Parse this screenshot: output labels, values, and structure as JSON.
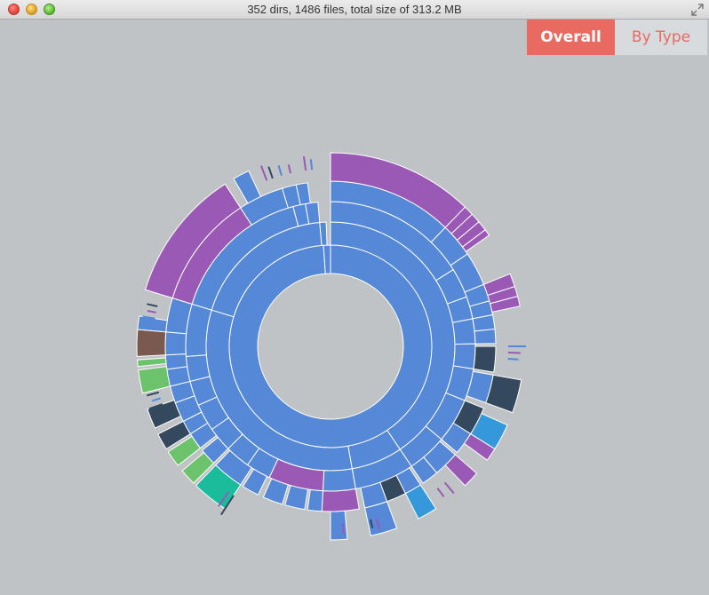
{
  "window": {
    "title": "352 dirs, 1486 files, total size of 313.2 MB"
  },
  "tabs": {
    "overall_label": "Overall",
    "bytype_label": "By Type",
    "active": "overall"
  },
  "colors": {
    "folder": "#5588d6",
    "purple": "#9b59b6",
    "dark": "#34495e",
    "green": "#6cc36c",
    "teal": "#1abc9c",
    "blue": "#3498db",
    "brown": "#7a5a50",
    "tab_active_bg": "#e96a60",
    "background": "#bfc3c6"
  },
  "chart_data": {
    "type": "sunburst",
    "segments": [
      {
        "depth": 0,
        "start": 0,
        "end": 356,
        "color": "folder"
      },
      {
        "depth": 0,
        "start": 356,
        "end": 360,
        "color": "folder"
      },
      {
        "depth": 1,
        "start": 0,
        "end": 146,
        "color": "folder"
      },
      {
        "depth": 1,
        "start": 146,
        "end": 170,
        "color": "folder"
      },
      {
        "depth": 1,
        "start": 170,
        "end": 287,
        "color": "folder"
      },
      {
        "depth": 1,
        "start": 287,
        "end": 355,
        "color": "folder"
      },
      {
        "depth": 1,
        "start": 355,
        "end": 358,
        "color": "folder"
      },
      {
        "depth": 2,
        "start": 0,
        "end": 58,
        "color": "folder"
      },
      {
        "depth": 2,
        "start": 58,
        "end": 70,
        "color": "folder"
      },
      {
        "depth": 2,
        "start": 70,
        "end": 79,
        "color": "folder"
      },
      {
        "depth": 2,
        "start": 79,
        "end": 89,
        "color": "folder"
      },
      {
        "depth": 2,
        "start": 89,
        "end": 99,
        "color": "folder"
      },
      {
        "depth": 2,
        "start": 99,
        "end": 112,
        "color": "folder"
      },
      {
        "depth": 2,
        "start": 112,
        "end": 130,
        "color": "folder"
      },
      {
        "depth": 2,
        "start": 130,
        "end": 146,
        "color": "folder"
      },
      {
        "depth": 2,
        "start": 146,
        "end": 170,
        "color": "folder"
      },
      {
        "depth": 2,
        "start": 170,
        "end": 183,
        "color": "folder"
      },
      {
        "depth": 2,
        "start": 183,
        "end": 205,
        "color": "purple"
      },
      {
        "depth": 2,
        "start": 205,
        "end": 215,
        "color": "folder"
      },
      {
        "depth": 2,
        "start": 215,
        "end": 225,
        "color": "folder"
      },
      {
        "depth": 2,
        "start": 225,
        "end": 235,
        "color": "folder"
      },
      {
        "depth": 2,
        "start": 235,
        "end": 246,
        "color": "folder"
      },
      {
        "depth": 2,
        "start": 246,
        "end": 256,
        "color": "folder"
      },
      {
        "depth": 2,
        "start": 256,
        "end": 266,
        "color": "folder"
      },
      {
        "depth": 2,
        "start": 266,
        "end": 287,
        "color": "folder"
      },
      {
        "depth": 2,
        "start": 287,
        "end": 345,
        "color": "folder"
      },
      {
        "depth": 2,
        "start": 345,
        "end": 350,
        "color": "folder"
      },
      {
        "depth": 2,
        "start": 350,
        "end": 355,
        "color": "folder"
      },
      {
        "depth": 3,
        "start": 0,
        "end": 44,
        "color": "folder"
      },
      {
        "depth": 3,
        "start": 44,
        "end": 56,
        "color": "folder"
      },
      {
        "depth": 3,
        "start": 56,
        "end": 68,
        "color": "folder"
      },
      {
        "depth": 3,
        "start": 68,
        "end": 74,
        "color": "folder"
      },
      {
        "depth": 3,
        "start": 74,
        "end": 79,
        "color": "folder"
      },
      {
        "depth": 3,
        "start": 79,
        "end": 84,
        "color": "folder"
      },
      {
        "depth": 3,
        "start": 84,
        "end": 89,
        "color": "folder"
      },
      {
        "depth": 3,
        "start": 90,
        "end": 99,
        "color": "dark"
      },
      {
        "depth": 3,
        "start": 100,
        "end": 110,
        "color": "folder"
      },
      {
        "depth": 3,
        "start": 112,
        "end": 122,
        "color": "dark"
      },
      {
        "depth": 3,
        "start": 122,
        "end": 130,
        "color": "folder"
      },
      {
        "depth": 3,
        "start": 131,
        "end": 140,
        "color": "folder"
      },
      {
        "depth": 3,
        "start": 140,
        "end": 146,
        "color": "folder"
      },
      {
        "depth": 3,
        "start": 147,
        "end": 153,
        "color": "folder"
      },
      {
        "depth": 3,
        "start": 153,
        "end": 160,
        "color": "dark"
      },
      {
        "depth": 3,
        "start": 160,
        "end": 168,
        "color": "folder"
      },
      {
        "depth": 3,
        "start": 170,
        "end": 183,
        "color": "purple"
      },
      {
        "depth": 3,
        "start": 183,
        "end": 188,
        "color": "folder"
      },
      {
        "depth": 3,
        "start": 189,
        "end": 196,
        "color": "folder"
      },
      {
        "depth": 3,
        "start": 197,
        "end": 204,
        "color": "folder"
      },
      {
        "depth": 3,
        "start": 206,
        "end": 212,
        "color": "folder"
      },
      {
        "depth": 3,
        "start": 213,
        "end": 224,
        "color": "folder"
      },
      {
        "depth": 3,
        "start": 225,
        "end": 231,
        "color": "folder"
      },
      {
        "depth": 3,
        "start": 232,
        "end": 238,
        "color": "folder"
      },
      {
        "depth": 3,
        "start": 238,
        "end": 243,
        "color": "folder"
      },
      {
        "depth": 3,
        "start": 243,
        "end": 250,
        "color": "folder"
      },
      {
        "depth": 3,
        "start": 250,
        "end": 256,
        "color": "folder"
      },
      {
        "depth": 3,
        "start": 256,
        "end": 262,
        "color": "folder"
      },
      {
        "depth": 3,
        "start": 262,
        "end": 267,
        "color": "folder"
      },
      {
        "depth": 3,
        "start": 267,
        "end": 275,
        "color": "folder"
      },
      {
        "depth": 3,
        "start": 275,
        "end": 287,
        "color": "folder"
      },
      {
        "depth": 3,
        "start": 287,
        "end": 327,
        "color": "purple"
      },
      {
        "depth": 3,
        "start": 327,
        "end": 343,
        "color": "folder"
      },
      {
        "depth": 3,
        "start": 343,
        "end": 348,
        "color": "folder"
      },
      {
        "depth": 3,
        "start": 348,
        "end": 352,
        "color": "folder"
      },
      {
        "depth": 4,
        "start": 0,
        "end": 44,
        "color": "purple"
      },
      {
        "depth": 4,
        "start": 44,
        "end": 47,
        "color": "purple"
      },
      {
        "depth": 4,
        "start": 47,
        "end": 50,
        "color": "purple"
      },
      {
        "depth": 4,
        "start": 50,
        "end": 53,
        "color": "purple"
      },
      {
        "depth": 4,
        "start": 53,
        "end": 55,
        "color": "purple"
      },
      {
        "depth": 4,
        "start": 68,
        "end": 72,
        "color": "purple"
      },
      {
        "depth": 4,
        "start": 72,
        "end": 75,
        "color": "purple"
      },
      {
        "depth": 4,
        "start": 75,
        "end": 78,
        "color": "purple"
      },
      {
        "depth": 4,
        "start": 100,
        "end": 110,
        "color": "dark"
      },
      {
        "depth": 4,
        "start": 114,
        "end": 122,
        "color": "blue"
      },
      {
        "depth": 4,
        "start": 122,
        "end": 126,
        "color": "purple"
      },
      {
        "depth": 4,
        "start": 131,
        "end": 136,
        "color": "purple"
      },
      {
        "depth": 4,
        "start": 147,
        "end": 153,
        "color": "blue"
      },
      {
        "depth": 4,
        "start": 160,
        "end": 168,
        "color": "folder"
      },
      {
        "depth": 4,
        "start": 175,
        "end": 180,
        "color": "folder"
      },
      {
        "depth": 4,
        "start": 213,
        "end": 224,
        "color": "teal"
      },
      {
        "depth": 4,
        "start": 225,
        "end": 230,
        "color": "green"
      },
      {
        "depth": 4,
        "start": 232,
        "end": 237,
        "color": "green"
      },
      {
        "depth": 4,
        "start": 238,
        "end": 243,
        "color": "dark"
      },
      {
        "depth": 4,
        "start": 245,
        "end": 251,
        "color": "dark"
      },
      {
        "depth": 4,
        "start": 256,
        "end": 263,
        "color": "green"
      },
      {
        "depth": 4,
        "start": 264,
        "end": 266,
        "color": "green"
      },
      {
        "depth": 4,
        "start": 267,
        "end": 275,
        "color": "brown"
      },
      {
        "depth": 4,
        "start": 275,
        "end": 279,
        "color": "folder"
      },
      {
        "depth": 4,
        "start": 287,
        "end": 327,
        "color": "purple"
      },
      {
        "depth": 4,
        "start": 330,
        "end": 335,
        "color": "folder"
      }
    ],
    "ticks": [
      {
        "angle": 140,
        "len": 16,
        "color": "purple"
      },
      {
        "angle": 143,
        "len": 12,
        "color": "purple"
      },
      {
        "angle": 165,
        "len": 14,
        "color": "purple"
      },
      {
        "angle": 167,
        "len": 10,
        "color": "dark"
      },
      {
        "angle": 176,
        "len": 12,
        "color": "purple"
      },
      {
        "angle": 213,
        "len": 26,
        "color": "dark"
      },
      {
        "angle": 215,
        "len": 20,
        "color": "purple"
      },
      {
        "angle": 251,
        "len": 16,
        "color": "dark"
      },
      {
        "angle": 253,
        "len": 10,
        "color": "folder"
      },
      {
        "angle": 255,
        "len": 14,
        "color": "dark"
      },
      {
        "angle": 279,
        "len": 14,
        "color": "folder"
      },
      {
        "angle": 281,
        "len": 10,
        "color": "purple"
      },
      {
        "angle": 283,
        "len": 12,
        "color": "dark"
      },
      {
        "angle": 339,
        "len": 18,
        "color": "purple"
      },
      {
        "angle": 341,
        "len": 14,
        "color": "dark"
      },
      {
        "angle": 344,
        "len": 12,
        "color": "folder"
      },
      {
        "angle": 347,
        "len": 10,
        "color": "purple"
      },
      {
        "angle": 352,
        "len": 16,
        "color": "purple"
      },
      {
        "angle": 354,
        "len": 12,
        "color": "folder"
      },
      {
        "angle": 90,
        "len": 20,
        "color": "folder"
      },
      {
        "angle": 92,
        "len": 14,
        "color": "purple"
      },
      {
        "angle": 94,
        "len": 12,
        "color": "folder"
      }
    ]
  }
}
